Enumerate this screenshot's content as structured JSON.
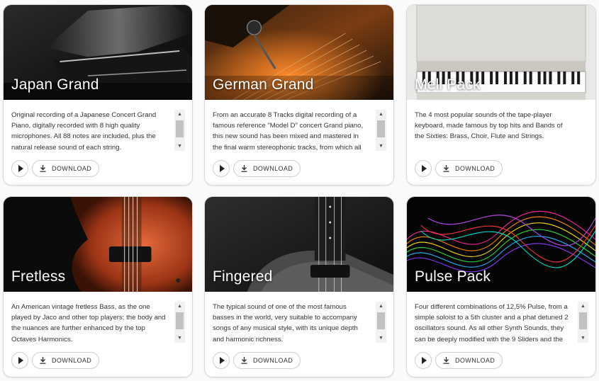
{
  "cards": [
    {
      "title": "Japan Grand",
      "description": "Original recording of a Japanese Concert Grand Piano, digitally recorded with 8 high quality microphones. All 88 notes are included, plus the natural release sound of each string.",
      "download_label": "DOWNLOAD",
      "has_scrollbar": true
    },
    {
      "title": "German Grand",
      "description": "From an accurate 8 Tracks digital recording of a famous reference \"Model D\" concert Grand piano, this new sound has been mixed and mastered in the final warm stereophonic tracks, from which all",
      "download_label": "DOWNLOAD",
      "has_scrollbar": true
    },
    {
      "title": "Mell Pack",
      "description": "The 4 most popular sounds of the tape-player keyboard, made famous by top hits and Bands of the Sixties: Brass, Choir, Flute and Strings.",
      "download_label": "DOWNLOAD",
      "has_scrollbar": false
    },
    {
      "title": "Fretless",
      "description": "An American vintage fretless Bass, as the one played by Jaco and other top players; the body and the nuances are further enhanced by the top Octaves Harmonics.",
      "download_label": "DOWNLOAD",
      "has_scrollbar": true
    },
    {
      "title": "Fingered",
      "description": "The typical sound of one of the most famous basses in the world, very suitable to accompany songs of any musical style, with its unique depth and harmonic richness.",
      "download_label": "DOWNLOAD",
      "has_scrollbar": true
    },
    {
      "title": "Pulse Pack",
      "description": "Four different combinations of 12,5% Pulse, from a simple soloist to a 5th cluster and a phat detuned 2 oscillators sound. As all other Synth Sounds, they can be deeply modified with the 9 Sliders and the",
      "download_label": "DOWNLOAD",
      "has_scrollbar": true
    }
  ],
  "icons": {
    "play": "play-icon",
    "download": "download-icon",
    "scroll_up": "chevron-up-icon",
    "scroll_down": "chevron-down-icon"
  },
  "colors": {
    "card_background": "#ffffff",
    "card_border": "#d9d9d9",
    "text": "#333333",
    "page_background": "#fafafa"
  }
}
